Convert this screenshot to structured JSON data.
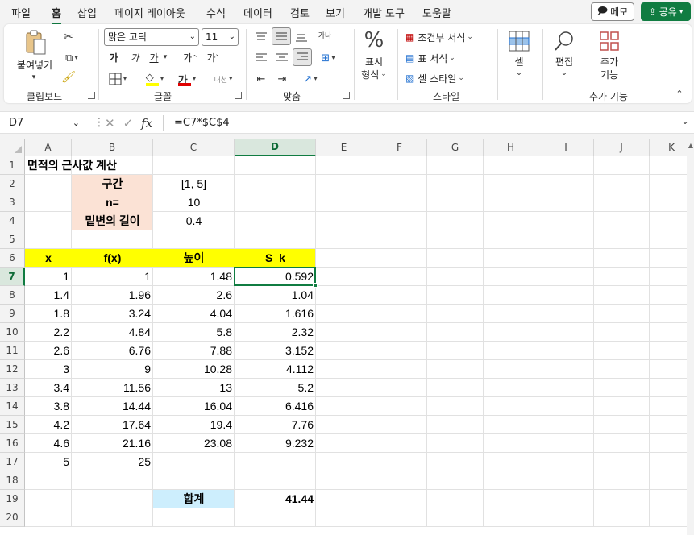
{
  "menu": {
    "tabs": [
      "파일",
      "홈",
      "삽입",
      "페이지 레이아웃",
      "수식",
      "데이터",
      "검토",
      "보기",
      "개발 도구",
      "도움말"
    ],
    "active": "홈",
    "memo_label": "메모",
    "share_label": "공유"
  },
  "ribbon": {
    "clipboard": {
      "paste_label": "붙여넣기",
      "group_label": "클립보드"
    },
    "font": {
      "font_name": "맑은 고딕",
      "font_size": "11",
      "bold": "가",
      "italic": "가",
      "underline": "가",
      "grow": "가",
      "shrink": "가",
      "font_color_glyph": "가",
      "phonetic": "내천",
      "group_label": "글꼴",
      "fill_color": "#ffff00",
      "font_color": "#e00000"
    },
    "alignment": {
      "wrap_label": "가나",
      "group_label": "맞춤"
    },
    "number": {
      "percent_glyph": "%",
      "label_line1": "표시",
      "label_line2": "형식"
    },
    "styles": {
      "conditional": "조건부 서식",
      "table_format": "표 서식",
      "cell_style": "셀 스타일",
      "group_label": "스타일"
    },
    "cells": {
      "label": "셀"
    },
    "editing": {
      "label": "편집"
    },
    "addins": {
      "label_line1": "추가",
      "label_line2": "기능",
      "group_label": "추가 기능"
    }
  },
  "formula_bar": {
    "name_box": "D7",
    "formula": "=C7*$C$4"
  },
  "sheet": {
    "columns": [
      "A",
      "B",
      "C",
      "D",
      "E",
      "F",
      "G",
      "H",
      "I",
      "J",
      "K"
    ],
    "rows": [
      "1",
      "2",
      "3",
      "4",
      "5",
      "6",
      "7",
      "8",
      "9",
      "10",
      "11",
      "12",
      "13",
      "14",
      "15",
      "16",
      "17",
      "18",
      "19",
      "20"
    ],
    "selected_column": "D",
    "selected_row": "7",
    "title": "면적의 근사값 계산",
    "params": [
      {
        "label": "구간",
        "value": "[1, 5]"
      },
      {
        "label": "n=",
        "value": "10"
      },
      {
        "label": "밑변의 길이",
        "value": "0.4"
      }
    ],
    "table_headers": [
      "x",
      "f(x)",
      "높이",
      "S_k"
    ],
    "table_rows": [
      [
        "1",
        "1",
        "1.48",
        "0.592"
      ],
      [
        "1.4",
        "1.96",
        "2.6",
        "1.04"
      ],
      [
        "1.8",
        "3.24",
        "4.04",
        "1.616"
      ],
      [
        "2.2",
        "4.84",
        "5.8",
        "2.32"
      ],
      [
        "2.6",
        "6.76",
        "7.88",
        "3.152"
      ],
      [
        "3",
        "9",
        "10.28",
        "4.112"
      ],
      [
        "3.4",
        "11.56",
        "13",
        "5.2"
      ],
      [
        "3.8",
        "14.44",
        "16.04",
        "6.416"
      ],
      [
        "4.2",
        "17.64",
        "19.4",
        "7.76"
      ],
      [
        "4.6",
        "21.16",
        "23.08",
        "9.232"
      ],
      [
        "5",
        "25",
        "",
        ""
      ]
    ],
    "total_label": "합계",
    "total_value": "41.44",
    "colors": {
      "param_fill": "#fbe2d5",
      "header_fill": "#ffff00",
      "total_fill": "#cdeefd",
      "accent": "#107c41"
    }
  }
}
